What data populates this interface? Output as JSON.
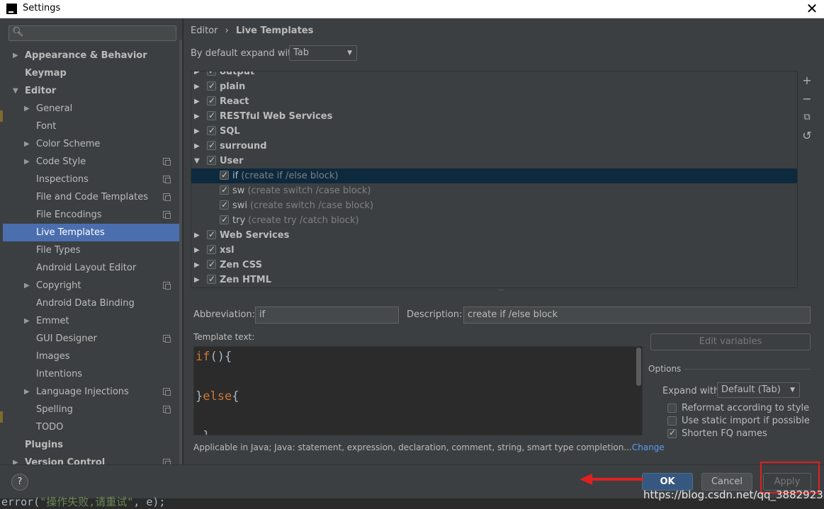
{
  "window": {
    "title": "Settings",
    "close_label": "✕"
  },
  "sidebar": {
    "search": {
      "value": "",
      "placeholder": ""
    },
    "items": [
      {
        "label": "Appearance & Behavior",
        "bold": true,
        "arrow": "▶"
      },
      {
        "label": "Keymap",
        "bold": true
      },
      {
        "label": "Editor",
        "bold": true,
        "arrow": "▼"
      },
      {
        "label": "General",
        "arrow": "▶"
      },
      {
        "label": "Font"
      },
      {
        "label": "Color Scheme",
        "arrow": "▶"
      },
      {
        "label": "Code Style",
        "arrow": "▶",
        "project": true
      },
      {
        "label": "Inspections",
        "project": true
      },
      {
        "label": "File and Code Templates",
        "project": true
      },
      {
        "label": "File Encodings",
        "project": true
      },
      {
        "label": "Live Templates",
        "selected": true
      },
      {
        "label": "File Types"
      },
      {
        "label": "Android Layout Editor"
      },
      {
        "label": "Copyright",
        "arrow": "▶",
        "project": true
      },
      {
        "label": "Android Data Binding"
      },
      {
        "label": "Emmet",
        "arrow": "▶"
      },
      {
        "label": "GUI Designer",
        "project": true
      },
      {
        "label": "Images"
      },
      {
        "label": "Intentions"
      },
      {
        "label": "Language Injections",
        "arrow": "▶",
        "project": true
      },
      {
        "label": "Spelling",
        "project": true
      },
      {
        "label": "TODO"
      },
      {
        "label": "Plugins",
        "bold": true
      },
      {
        "label": "Version Control",
        "bold": true,
        "arrow": "▶",
        "project": true
      }
    ]
  },
  "main": {
    "breadcrumb": {
      "parent": "Editor",
      "separator": "›",
      "current": "Live Templates"
    },
    "expand_label": "By default expand with",
    "expand_value": "Tab",
    "templates": [
      {
        "name": "output",
        "group": true,
        "arrow": "▶",
        "checked": true
      },
      {
        "name": "plain",
        "group": true,
        "arrow": "▶",
        "checked": true
      },
      {
        "name": "React",
        "group": true,
        "arrow": "▶",
        "checked": true
      },
      {
        "name": "RESTful Web Services",
        "group": true,
        "arrow": "▶",
        "checked": true
      },
      {
        "name": "SQL",
        "group": true,
        "arrow": "▶",
        "checked": true
      },
      {
        "name": "surround",
        "group": true,
        "arrow": "▶",
        "checked": true
      },
      {
        "name": "User",
        "group": true,
        "arrow": "▼",
        "checked": true
      },
      {
        "name": "if",
        "desc": "(create if /else block)",
        "checked": true,
        "selected": true
      },
      {
        "name": "sw",
        "desc": "(create switch /case block)",
        "checked": true
      },
      {
        "name": "swi",
        "desc": "(create switch /case block)",
        "checked": true
      },
      {
        "name": "try",
        "desc": "(create try /catch block)",
        "checked": true
      },
      {
        "name": "Web Services",
        "group": true,
        "arrow": "▶",
        "checked": true
      },
      {
        "name": "xsl",
        "group": true,
        "arrow": "▶",
        "checked": true
      },
      {
        "name": "Zen CSS",
        "group": true,
        "arrow": "▶",
        "checked": true
      },
      {
        "name": "Zen HTML",
        "group": true,
        "arrow": "▶",
        "checked": true
      }
    ],
    "tools": {
      "add": "+",
      "remove": "−",
      "copy": "⧉",
      "restore": "↺"
    },
    "abbreviation_label": "Abbreviation:",
    "abbreviation_value": "if",
    "description_label": "Description:",
    "description_value": "create if /else block",
    "template_text_label": "Template text:",
    "template_lines": [
      {
        "kw": "if",
        "rest": "(){"
      },
      {
        "kw": "",
        "rest": ""
      },
      {
        "kw": "",
        "rest": "}",
        "kw2": "else",
        "rest2": "{"
      },
      {
        "kw": "",
        "rest": ""
      },
      {
        "kw": "",
        "rest": " }"
      }
    ],
    "edit_variables": "Edit variables",
    "options_label": "Options",
    "options_expand_label": "Expand with",
    "options_expand_value": "Default (Tab)",
    "options": [
      {
        "label": "Reformat according to style",
        "checked": false
      },
      {
        "label": "Use static import if possible",
        "checked": false
      },
      {
        "label": "Shorten FQ names",
        "checked": true
      }
    ],
    "applicable_text": "Applicable in Java; Java: statement, expression, declaration, comment, string, smart type completion...",
    "applicable_link": "Change"
  },
  "buttons": {
    "help": "?",
    "ok": "OK",
    "cancel": "Cancel",
    "apply": "Apply"
  },
  "footer_code": {
    "pre": "error(",
    "str": "\"操作失败,请重试\"",
    "post": ", e);"
  },
  "watermark": "https://blog.csdn.net/qq_38829237",
  "colors": {
    "accent": "#4b6eaf",
    "selection_dark": "#0d293e",
    "ok_button": "#365880",
    "annotation_red": "#e02020",
    "link": "#589df6"
  }
}
